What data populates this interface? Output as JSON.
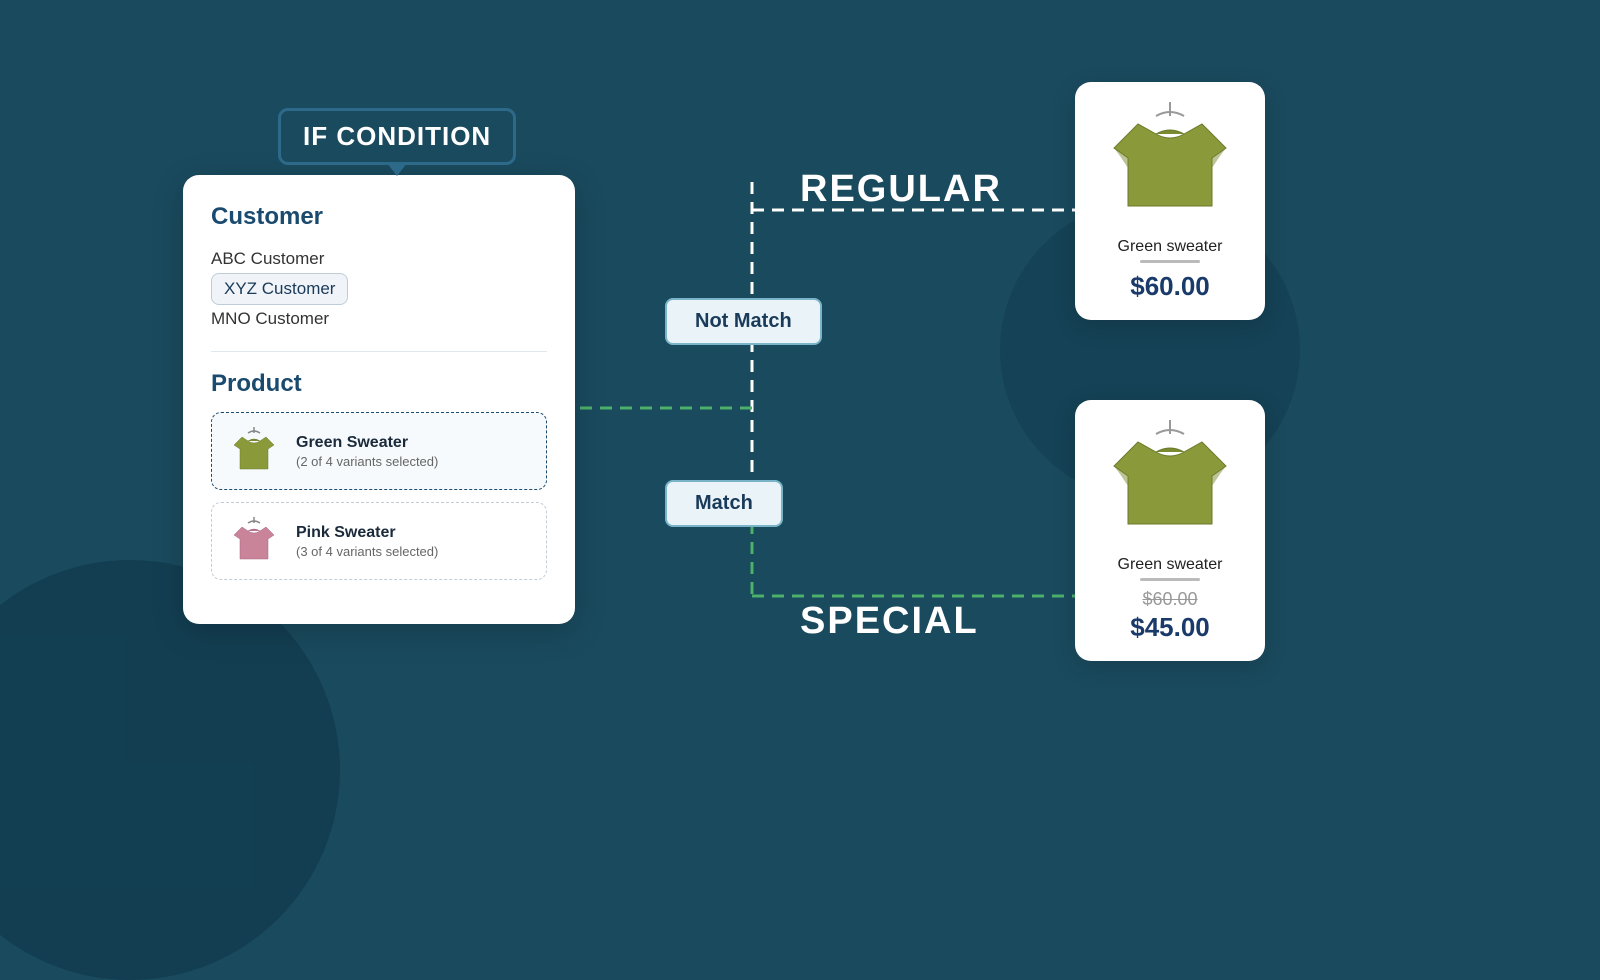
{
  "condition_label": "IF CONDITION",
  "panel": {
    "customer_section": "Customer",
    "customers": [
      {
        "name": "ABC Customer",
        "selected": false
      },
      {
        "name": "XYZ Customer",
        "selected": true
      },
      {
        "name": "MNO Customer",
        "selected": false
      }
    ],
    "product_section": "Product",
    "products": [
      {
        "name": "Green Sweater",
        "variants": "(2 of 4 variants selected)",
        "selected": true,
        "color": "green"
      },
      {
        "name": "Pink Sweater",
        "variants": "(3 of 4 variants selected)",
        "selected": false,
        "color": "pink"
      }
    ]
  },
  "flow": {
    "not_match": "Not Match",
    "match": "Match"
  },
  "labels": {
    "regular": "REGULAR",
    "special": "SPECIAL"
  },
  "result_regular": {
    "product_name": "Green sweater",
    "price": "$60.00"
  },
  "result_special": {
    "product_name": "Green sweater",
    "price_original": "$60.00",
    "price_special": "$45.00"
  }
}
